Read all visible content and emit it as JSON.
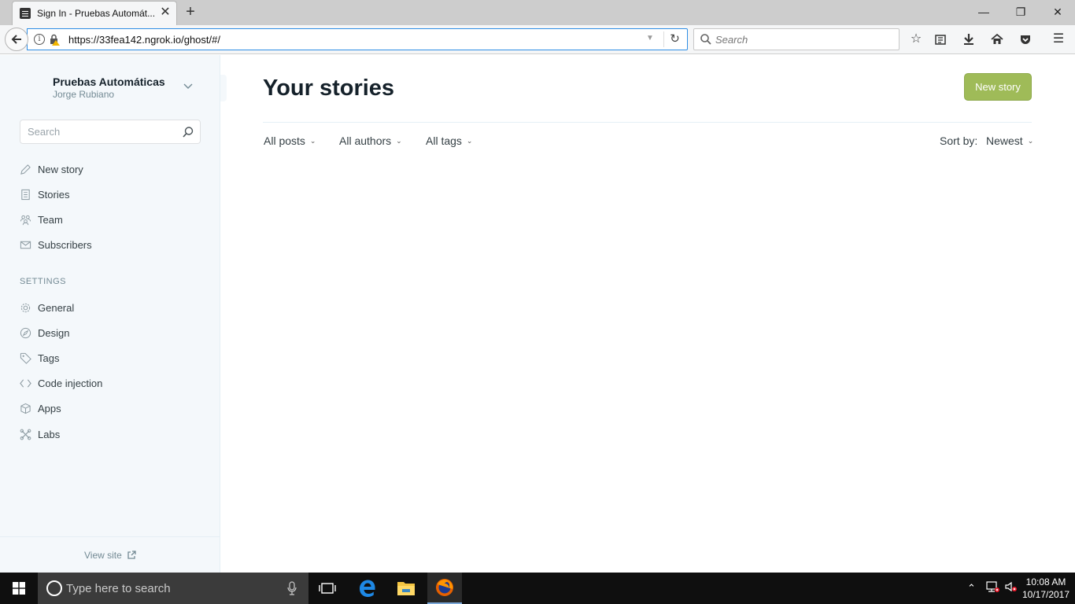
{
  "browser": {
    "tab_title": "Sign In - Pruebas Automát...",
    "url": "https://33fea142.ngrok.io/ghost/#/",
    "search_placeholder": "Search"
  },
  "sidebar": {
    "blog_title": "Pruebas Automáticas",
    "user_name": "Jorge Rubiano",
    "search_placeholder": "Search",
    "nav": {
      "new_story": "New story",
      "stories": "Stories",
      "team": "Team",
      "subscribers": "Subscribers"
    },
    "settings_heading": "SETTINGS",
    "settings": {
      "general": "General",
      "design": "Design",
      "tags": "Tags",
      "code_injection": "Code injection",
      "apps": "Apps",
      "labs": "Labs"
    },
    "view_site": "View site"
  },
  "main": {
    "title": "Your stories",
    "new_story_button": "New story",
    "filters": {
      "posts": "All posts",
      "authors": "All authors",
      "tags": "All tags"
    },
    "sort_label": "Sort by:",
    "sort_value": "Newest"
  },
  "taskbar": {
    "search_placeholder": "Type here to search",
    "time": "10:08 AM",
    "date": "10/17/2017"
  },
  "colors": {
    "accent_green": "#9fbb58",
    "sidebar_bg": "#f4f8fb",
    "url_focus": "#2f8ee5"
  }
}
